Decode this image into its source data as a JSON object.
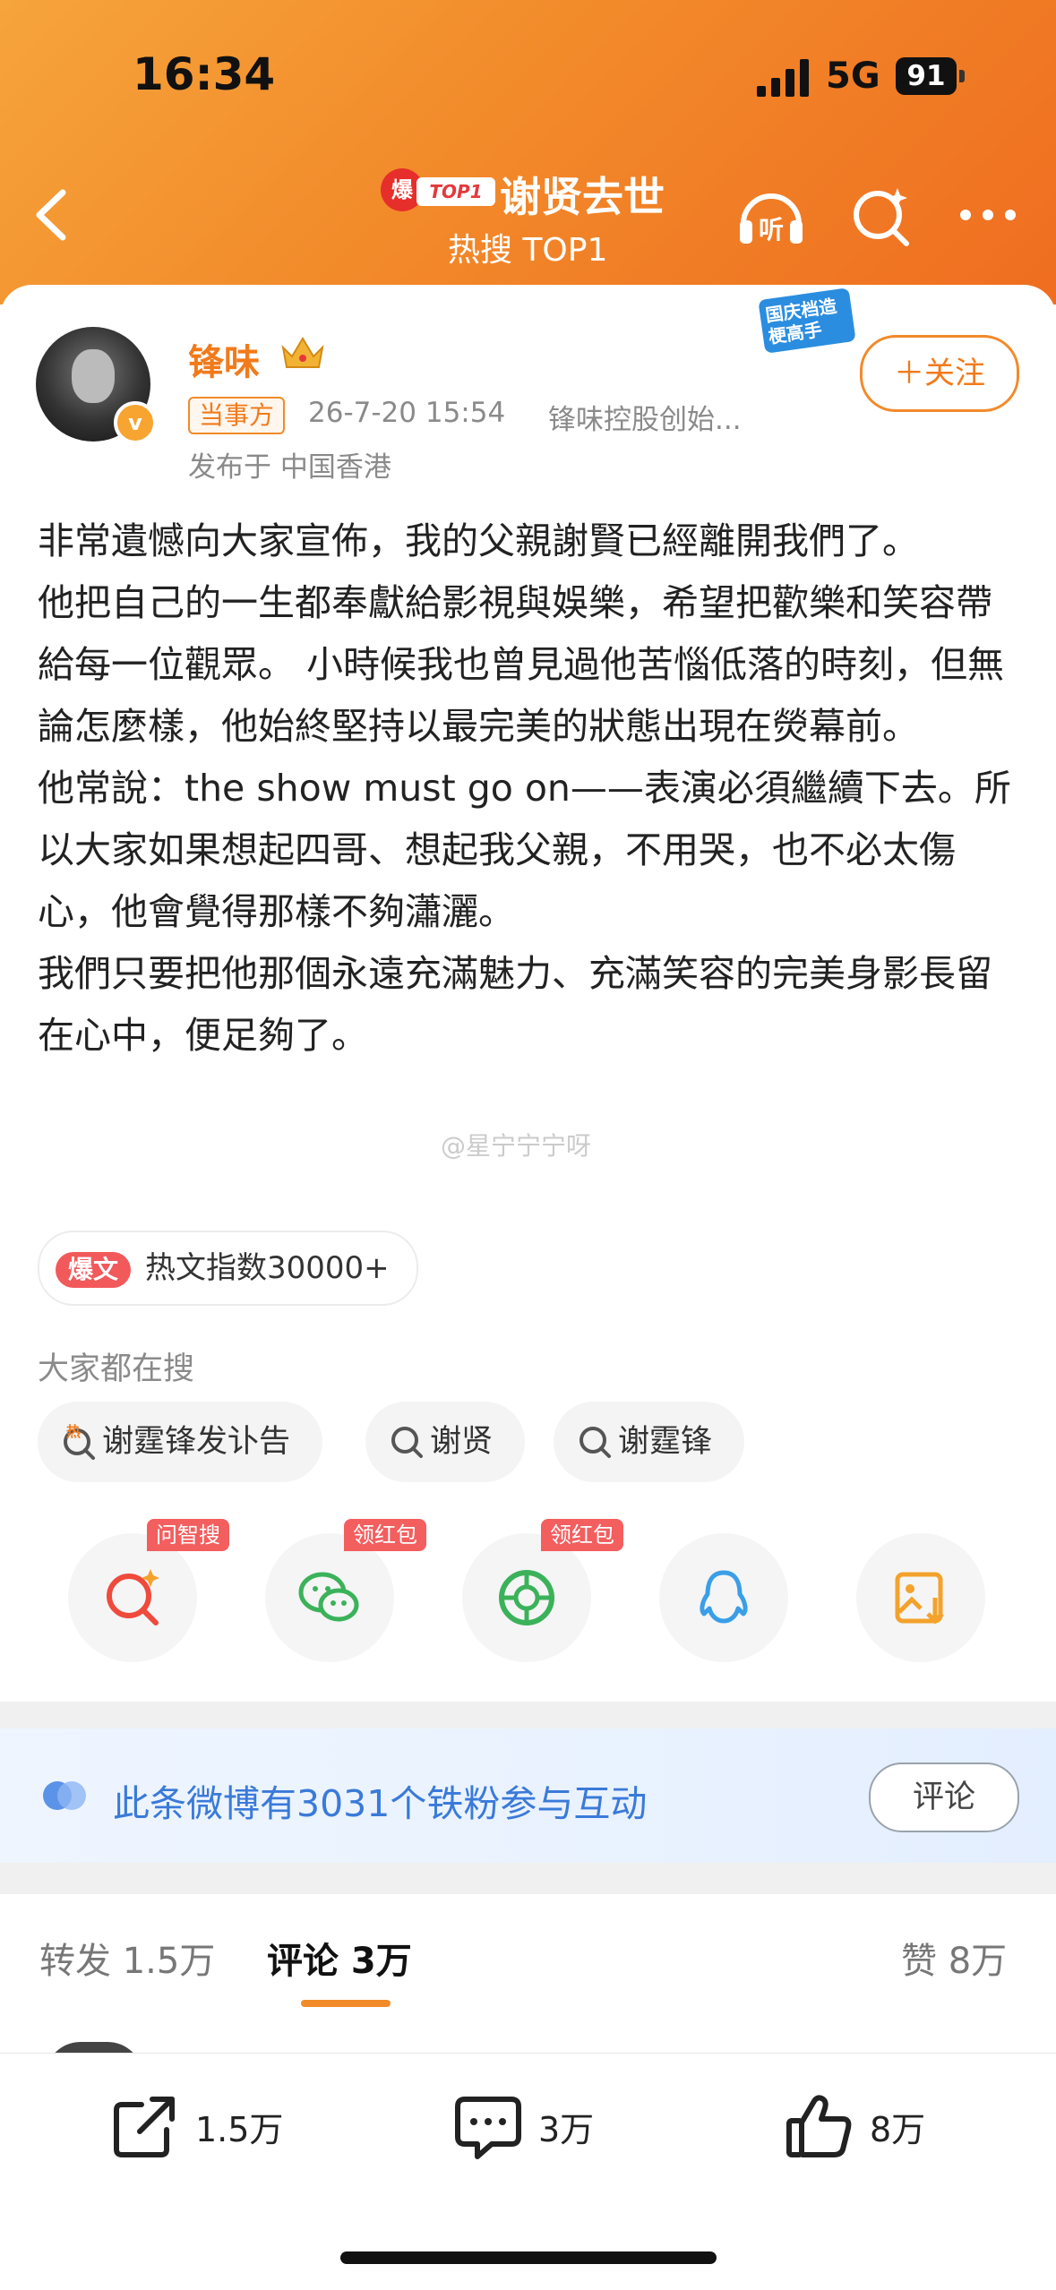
{
  "status_bar": {
    "time": "16:34",
    "network": "5G",
    "battery": "91"
  },
  "header": {
    "hot_icon": "爆",
    "top_badge": "TOP1",
    "title": "谢贤去世",
    "subtitle": "热搜 TOP1",
    "icons": [
      "back-icon",
      "listen-icon",
      "search-icon",
      "more-icon"
    ],
    "listen_label": "听"
  },
  "post": {
    "username": "锋味",
    "badge_icon": "crown-icon",
    "verified_mark": "v",
    "tag": "当事方",
    "time": "26-7-20 15:54",
    "source": "锋味控股创始...",
    "location": "发布于 中国香港",
    "follow_label": "＋关注",
    "promo_text": "国庆档造梗高手",
    "paragraphs": [
      "非常遺憾向大家宣佈，我的父親謝賢已經離開我們了。",
      "他把自己的一生都奉獻給影視與娛樂，希望把歡樂和笑容帶給每一位觀眾。 小時候我也曾見過他苦惱低落的時刻，但無論怎麼樣，他始終堅持以最完美的狀態出現在熒幕前。",
      "他常說：the show must go on——表演必須繼續下去。所以大家如果想起四哥、想起我父親，不用哭，也不必太傷心，他會覺得那樣不夠瀟灑。",
      "我們只要把他那個永遠充滿魅力、充滿笑容的完美身影長留在心中，便足夠了。"
    ],
    "watermark": "@星宁宁宁呀"
  },
  "hot_index": {
    "pill": "爆文",
    "text": "热文指数30000+"
  },
  "related_search": {
    "title": "大家都在搜",
    "chips": [
      "谢霆锋发讣告",
      "谢贤",
      "谢霆锋"
    ],
    "first_chip_icon_text": "热"
  },
  "share": {
    "items": [
      {
        "icon": "ai-search-icon",
        "tag": "问智搜"
      },
      {
        "icon": "wechat-icon",
        "tag": "领红包"
      },
      {
        "icon": "moments-icon",
        "tag": "领红包"
      },
      {
        "icon": "qq-icon",
        "tag": ""
      },
      {
        "icon": "save-image-icon",
        "tag": ""
      }
    ]
  },
  "fans": {
    "text": "此条微博有3031个铁粉参与互动",
    "button": "评论"
  },
  "tabs": {
    "repost": "转发 1.5万",
    "comment": "评论 3万",
    "like": "赞 8万"
  },
  "bottom_bar": {
    "repost": "1.5万",
    "comment": "3万",
    "like": "8万"
  },
  "colors": {
    "accent": "#f28a2a",
    "link_blue": "#3a7ad9",
    "red": "#e4393c"
  }
}
